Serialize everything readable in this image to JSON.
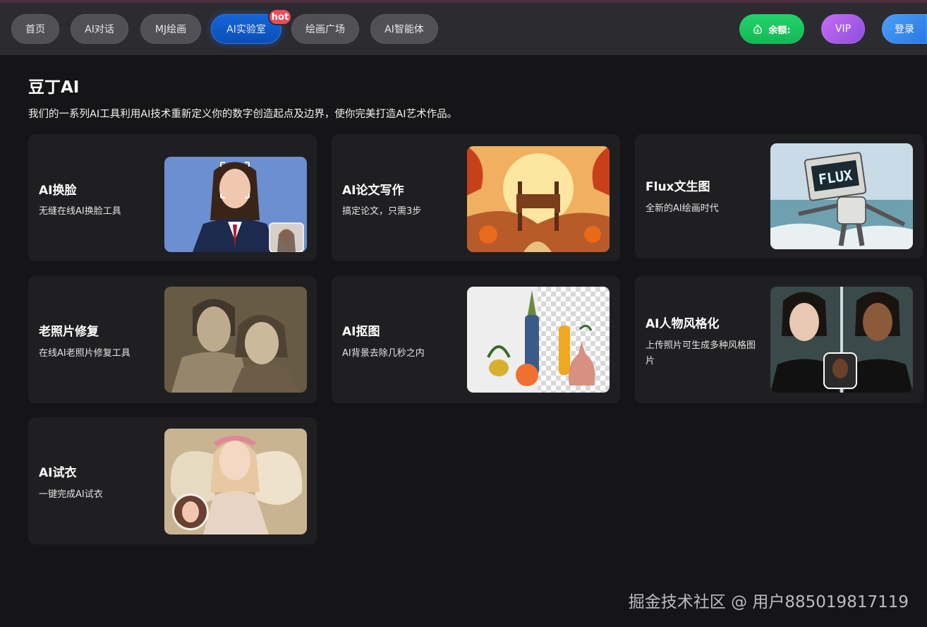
{
  "nav": {
    "items": [
      {
        "label": "首页"
      },
      {
        "label": "AI对话"
      },
      {
        "label": "MJ绘画"
      },
      {
        "label": "AI实验室"
      },
      {
        "label": "绘画广场"
      },
      {
        "label": "AI智能体"
      }
    ],
    "hot_badge": "hot",
    "balance_label": "余额:",
    "vip_label": "VIP",
    "login_label": "登录"
  },
  "header": {
    "title": "豆丁AI",
    "description": "我们的一系列AI工具利用AI技术重新定义你的数字创造起点及边界，使你完美打造AI艺术作品。"
  },
  "cards": [
    {
      "title": "AI换脸",
      "desc": "无缝在线AI换脸工具"
    },
    {
      "title": "AI论文写作",
      "desc": "搞定论文，只需3步"
    },
    {
      "title": "Flux文生图",
      "desc": "全新的AI绘画时代",
      "image_text": "FLUX"
    },
    {
      "title": "老照片修复",
      "desc": "在线AI老照片修复工具"
    },
    {
      "title": "AI抠图",
      "desc": "AI背景去除几秒之内"
    },
    {
      "title": "AI人物风格化",
      "desc": "上传照片可生成多种风格图片"
    },
    {
      "title": "AI试衣",
      "desc": "一键完成AI试衣"
    }
  ],
  "watermark": "掘金技术社区 @ 用户885019817119",
  "colors": {
    "active_nav": "#0a4fb8",
    "hot": "#ee4c57",
    "balance": "#14b855",
    "vip": "#a05ee8",
    "login": "#3a8cf0"
  },
  "icons": {
    "balance": "money-bag-icon"
  }
}
